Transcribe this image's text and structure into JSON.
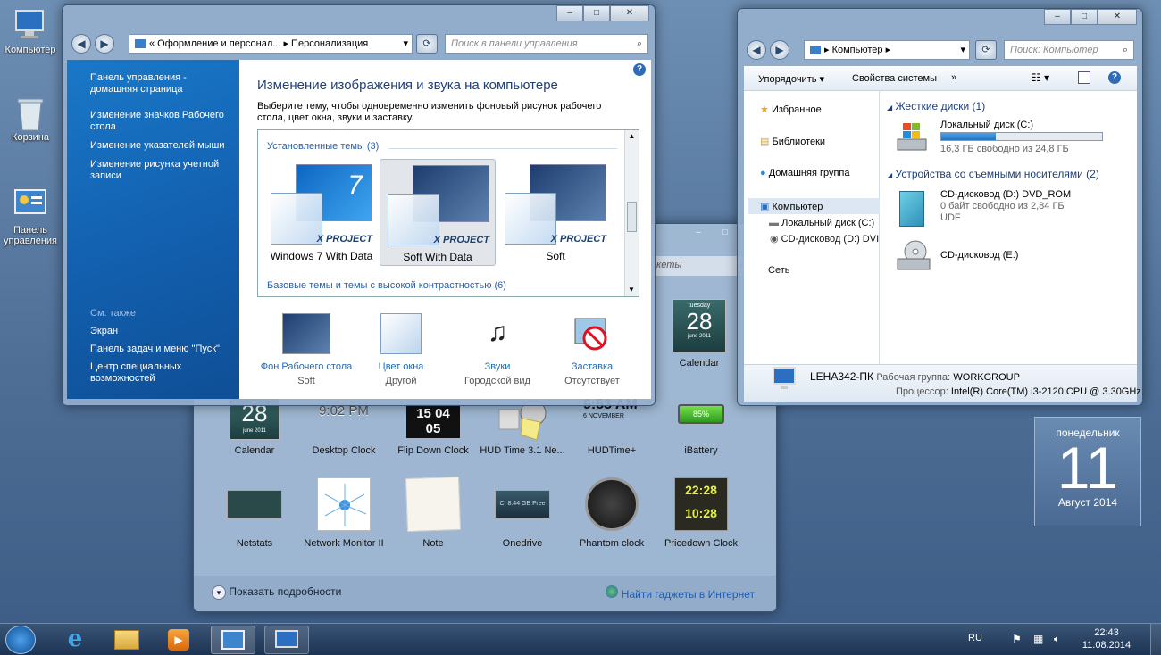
{
  "desktop": {
    "icons": [
      {
        "label": "Компьютер"
      },
      {
        "label": "Корзина"
      },
      {
        "label": "Панель управления"
      }
    ]
  },
  "personalization": {
    "address": "« Оформление и персонал... ▸ Персонализация",
    "search_placeholder": "Поиск в панели управления",
    "sidebar_links": [
      "Панель управления - домашняя страница",
      "Изменение значков Рабочего стола",
      "Изменение указателей мыши",
      "Изменение рисунка учетной записи"
    ],
    "see_also_header": "См. также",
    "see_also": [
      "Экран",
      "Панель задач и меню \"Пуск\"",
      "Центр специальных возможностей"
    ],
    "title": "Изменение изображения и звука на компьютере",
    "description": "Выберите тему, чтобы одновременно изменить фоновый рисунок рабочего стола, цвет окна, звуки и заставку.",
    "installed_header": "Установленные темы (3)",
    "themes": [
      {
        "name": "Windows 7 With Data",
        "badge": "X PROJECT",
        "numeral": "7"
      },
      {
        "name": "Soft With Data",
        "badge": "X PROJECT"
      },
      {
        "name": "Soft",
        "badge": "X PROJECT"
      }
    ],
    "basic_header": "Базовые темы и темы с высокой контрастностью (6)",
    "bottom": [
      {
        "label": "Фон Рабочего стола",
        "value": "Soft"
      },
      {
        "label": "Цвет окна",
        "value": "Другой"
      },
      {
        "label": "Звуки",
        "value": "Городской вид"
      },
      {
        "label": "Заставка",
        "value": "Отсутствует"
      }
    ]
  },
  "explorer": {
    "address": "▸ Компьютер ▸",
    "search_placeholder": "Поиск: Компьютер",
    "toolbar": {
      "organize": "Упорядочить ▾",
      "system_props": "Свойства системы",
      "more": "»"
    },
    "nav": {
      "favorites": "Избранное",
      "libraries": "Библиотеки",
      "homegroup": "Домашняя группа",
      "computer": "Компьютер",
      "local_disk": "Локальный диск (C:)",
      "cd_drive": "CD-дисковод (D:) DVI",
      "network": "Сеть"
    },
    "hdd_header": "Жесткие диски (1)",
    "local_disk": {
      "name": "Локальный диск (C:)",
      "free": "16,3 ГБ свободно из 24,8 ГБ",
      "used_fraction": 0.34
    },
    "removable_header": "Устройства со съемными носителями (2)",
    "cd_d": {
      "name": "CD-дисковод (D:) DVD_ROM",
      "free": "0 байт свободно из 2,84 ГБ",
      "fs": "UDF"
    },
    "cd_e": {
      "name": "CD-дисковод (E:)"
    },
    "details": {
      "pc_name": "LEHA342-ПК",
      "workgroup_label": "Рабочая группа:",
      "workgroup": "WORKGROUP",
      "cpu_label": "Процессор:",
      "cpu": "Intel(R) Core(TM) i3-2120 CPU @ 3.30GHz"
    }
  },
  "gadgets": {
    "search_placeholder": "кеты",
    "preview": {
      "day": "tuesday",
      "num": "28",
      "month": "june 2011",
      "label": "Calendar"
    },
    "row1": [
      "Calendar",
      "Desktop Clock",
      "Flip Down Clock",
      "HUD Time 3.1 Ne...",
      "HUDTime+",
      "iBattery"
    ],
    "row2": [
      "Netstats",
      "Network Monitor II",
      "Note",
      "Onedrive",
      "Phantom clock",
      "Pricedown Clock"
    ],
    "cal_num": "28",
    "cal_month": "june 2011",
    "desktop_clock_time": "9:02 PM",
    "flip_time": "15 04 05",
    "hud_time": "9:53 AM",
    "hud_date": "6 NOVEMBER",
    "battery": "85%",
    "onedrive_text": "C: 8.44 GB Free",
    "pricedown": [
      "22:28",
      "10:28"
    ],
    "show_details": "Показать подробности",
    "get_online": "Найти гаджеты в Интернет"
  },
  "calendar_widget": {
    "weekday": "понедельник",
    "day": "11",
    "month": "Август 2014"
  },
  "taskbar": {
    "lang": "RU",
    "time": "22:43",
    "date": "11.08.2014"
  },
  "colors": {
    "accent_link": "#1e6bb8",
    "sidebar_blue": "#1566b4",
    "taskbar": "#1a2f4a"
  }
}
